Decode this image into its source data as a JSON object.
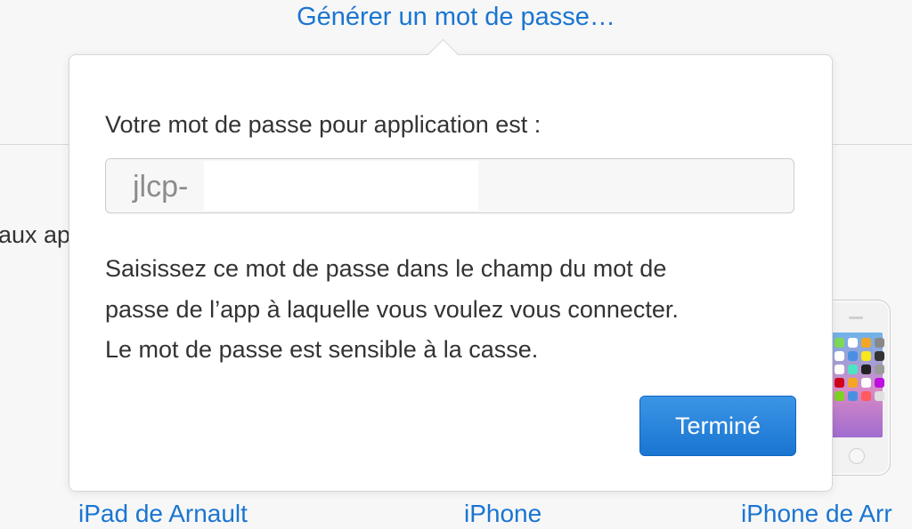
{
  "header": {
    "generate_link": "Générer un mot de passe…"
  },
  "background": {
    "side_text": "aux ap"
  },
  "dialog": {
    "prompt": "Votre mot de passe pour application est :",
    "password_value": "jlcp-",
    "instructions_line1": "Saisissez ce mot de passe dans le champ du mot de",
    "instructions_line2": "passe de l’app à laquelle vous voulez vous connecter.",
    "instructions_line3": "Le mot de passe est sensible à la casse.",
    "done_label": "Terminé"
  },
  "devices": [
    {
      "label": "iPad de Arnault"
    },
    {
      "label": "iPhone"
    },
    {
      "label": "iPhone de Arr"
    }
  ],
  "colors": {
    "link": "#1a75d1",
    "button": "#1a75d1",
    "text": "#333333"
  }
}
